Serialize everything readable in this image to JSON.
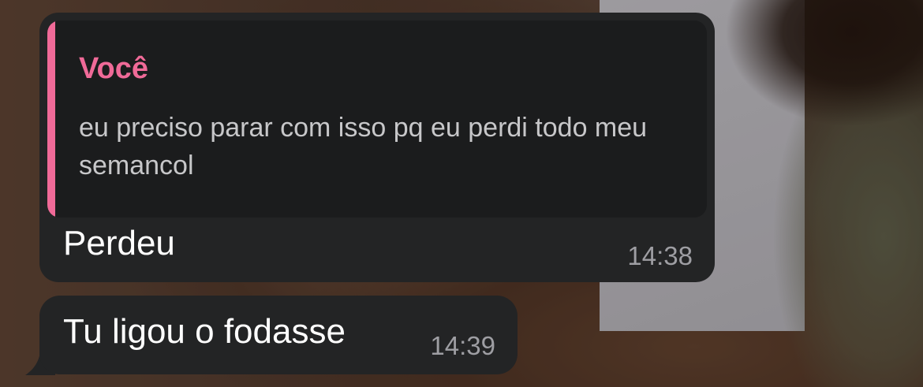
{
  "chat": {
    "messages": [
      {
        "reply_to": {
          "author": "Você",
          "text": "eu preciso parar com isso pq eu perdi todo meu semancol"
        },
        "text": "Perdeu",
        "time": "14:38"
      },
      {
        "text": "Tu ligou o fodasse",
        "time": "14:39"
      }
    ]
  },
  "colors": {
    "bubble": "#232425",
    "quote_background": "#1b1c1d",
    "quote_accent": "#f06a98",
    "message_text": "#ffffff",
    "timestamp": "#9e9ea3"
  }
}
